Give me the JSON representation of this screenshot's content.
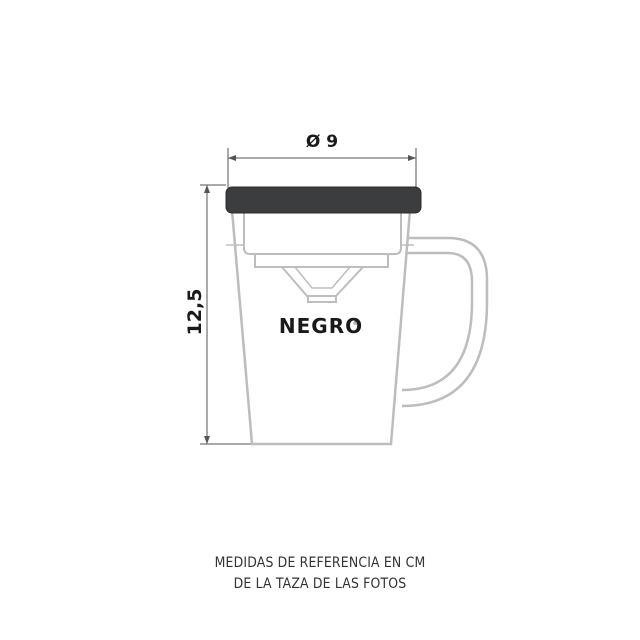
{
  "dimensions": {
    "diameter_label": "Ø 9",
    "height_label": "12,5"
  },
  "mug": {
    "brand": "NEGRO",
    "lid_color": "#3c3d3f",
    "outline_color": "#bdbdbd"
  },
  "caption": {
    "line1": "MEDIDAS DE REFERENCIA EN CM",
    "line2": "DE LA TAZA DE LAS FOTOS"
  }
}
